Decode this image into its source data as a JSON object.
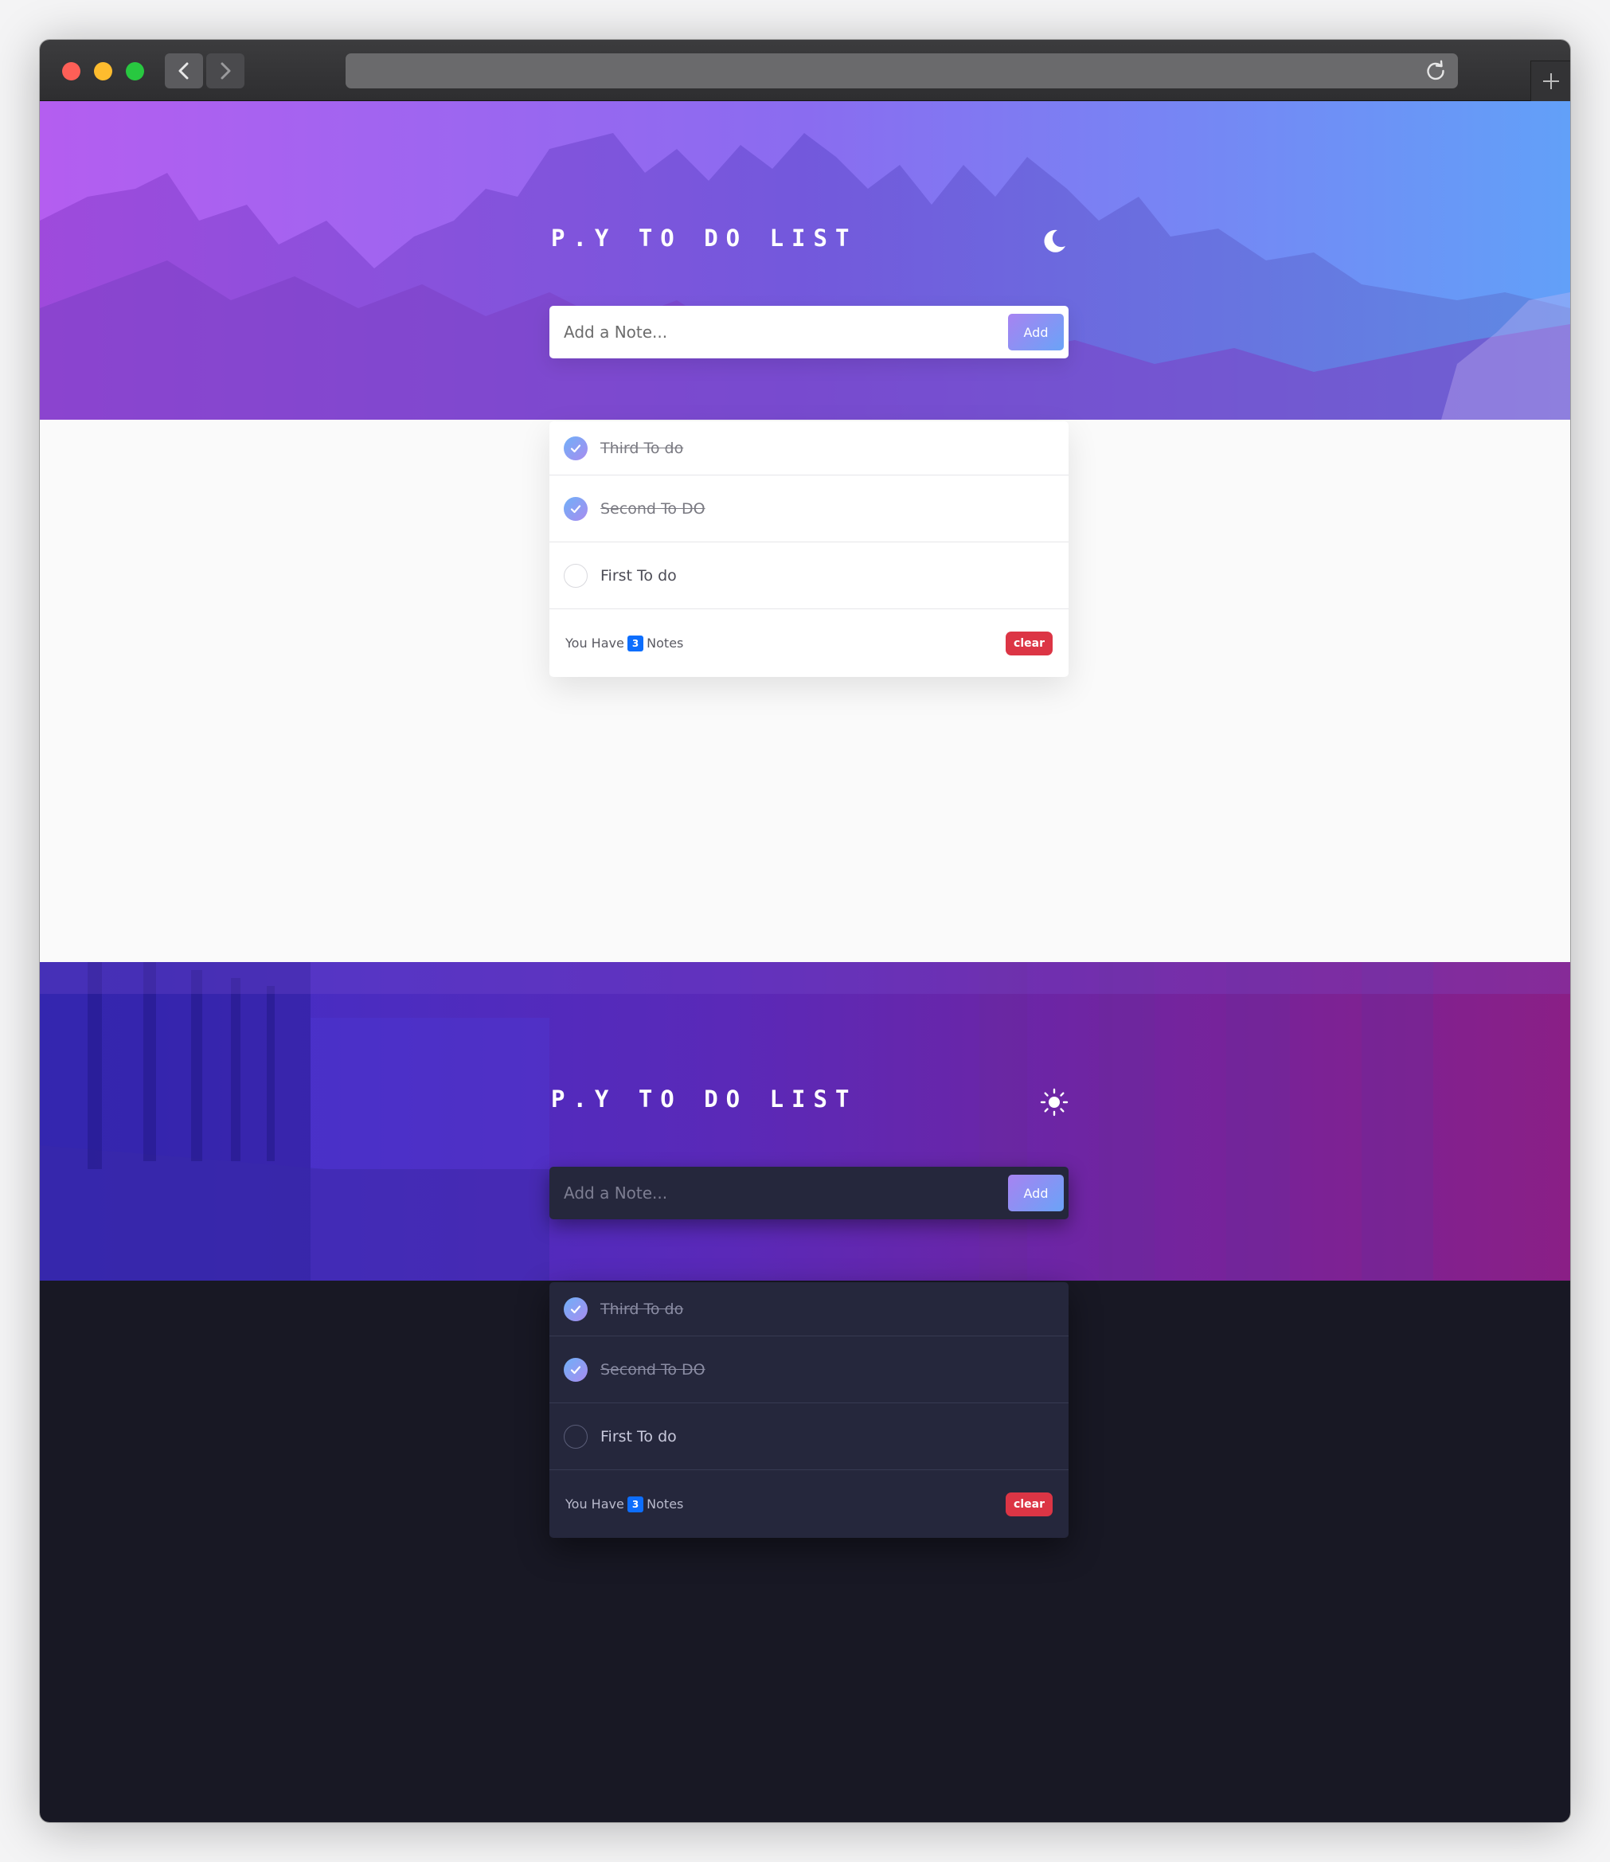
{
  "browser": {
    "icons": {
      "back": "chevron-left-icon",
      "forward": "chevron-right-icon",
      "reload": "reload-icon",
      "new_tab": "plus-icon"
    }
  },
  "colors": {
    "accent_gradient_start": "#a783f1",
    "accent_gradient_end": "#6aa3f7",
    "badge": "#0d6efd",
    "clear": "#dc3545",
    "light_bg": "#fafafa",
    "dark_bg": "#181824",
    "dark_card": "#25273c"
  },
  "light": {
    "title": "P.Y TO DO LIST",
    "theme_toggle_icon": "moon-icon",
    "input_placeholder": "Add a Note...",
    "add_label": "Add",
    "todos": [
      {
        "text": "Third To do",
        "done": true
      },
      {
        "text": "Second To DO",
        "done": true
      },
      {
        "text": "First To do",
        "done": false
      }
    ],
    "footer": {
      "prefix": "You Have",
      "count": "3",
      "suffix": "Notes",
      "clear_label": "clear"
    }
  },
  "dark": {
    "title": "P.Y TO DO LIST",
    "theme_toggle_icon": "sun-icon",
    "input_placeholder": "Add a Note...",
    "add_label": "Add",
    "todos": [
      {
        "text": "Third To do",
        "done": true
      },
      {
        "text": "Second To DO",
        "done": true
      },
      {
        "text": "First To do",
        "done": false
      }
    ],
    "footer": {
      "prefix": "You Have",
      "count": "3",
      "suffix": "Notes",
      "clear_label": "clear"
    }
  }
}
